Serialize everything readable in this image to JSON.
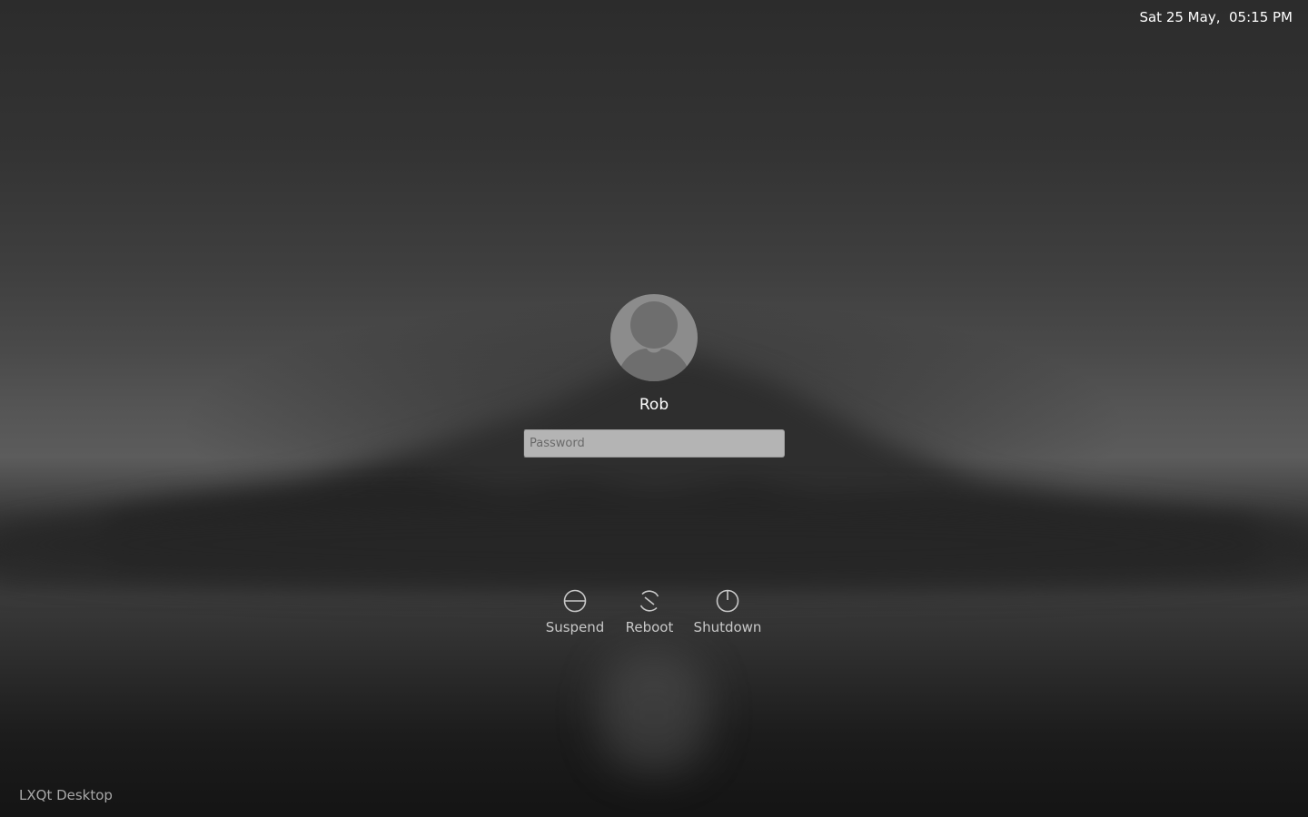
{
  "clock": {
    "date": "Sat 25 May,",
    "time": "05:15 PM"
  },
  "user": {
    "name": "Rob",
    "avatar_icon": "user-avatar-icon"
  },
  "password": {
    "value": "",
    "placeholder": "Password"
  },
  "power": {
    "suspend_label": "Suspend",
    "reboot_label": "Reboot",
    "shutdown_label": "Shutdown"
  },
  "session": {
    "label": "LXQt Desktop"
  },
  "colors": {
    "text": "#ffffff",
    "muted": "#c8c8c8",
    "avatar": "#8c8c8c",
    "input_bg": "#b4b4b4"
  }
}
